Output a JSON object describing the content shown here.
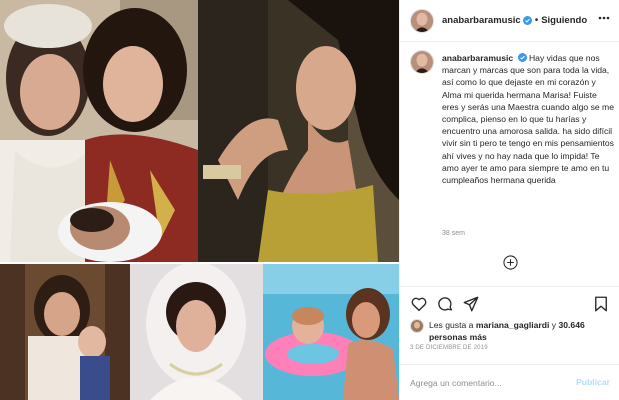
{
  "post": {
    "username": "anabarbaramusic",
    "follow_status": "Siguiendo",
    "separator": "•",
    "caption": "Hay vidas que nos marcan y marcas que son para toda la vida, así como lo que dejaste en mi corazón y Alma mi querida hermana Marisa! Fuiste eres y serás una Maestra cuando algo se me complica, pienso en lo que tu harías y encuentro una amorosa salida. ha sido difícil vivir sin ti pero te tengo en mis pensamientos ahí vives y no hay nada que lo impida! Te amo ayer te amo para siempre te amo en tu cumpleaños hermana querida",
    "time_ago": "38 sem"
  },
  "icons": {
    "verified": "verified-badge-icon",
    "more": "more-options-icon",
    "load_more": "load-more-comments-icon",
    "like": "heart-icon",
    "comment": "comment-bubble-icon",
    "share": "paper-plane-icon",
    "save": "bookmark-icon"
  },
  "likes": {
    "prefix": "Les gusta a ",
    "liker": "mariana_gagliardi",
    "conjunction": " y ",
    "count_text": "30.646 personas más"
  },
  "date": "3 DE DICIEMBRE DE 2019",
  "comment_box": {
    "placeholder": "Agrega un comentario...",
    "publish_label": "Publicar"
  },
  "colors": {
    "accent_link": "#0095f6",
    "publish_disabled": "#b3dbff",
    "muted": "#8e8e8e",
    "verified": "#3897f0"
  },
  "images": [
    {
      "name": "photo-two-women-with-baby"
    },
    {
      "name": "photo-smiling-woman-profile"
    },
    {
      "name": "photo-woman-holding-child"
    },
    {
      "name": "photo-bride-portrait"
    },
    {
      "name": "photo-girls-in-pool"
    }
  ]
}
